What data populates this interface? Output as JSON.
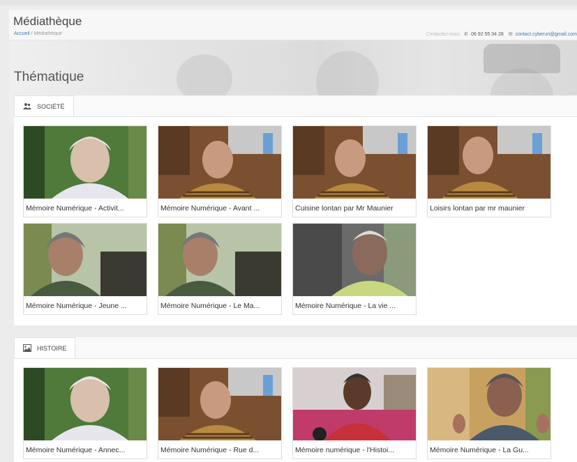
{
  "header": {
    "title": "Médiathèque",
    "breadcrumb_home": "Accueil",
    "breadcrumb_sep": "/",
    "breadcrumb_current": "Médiathèque",
    "contact_label": "Contactez-nous",
    "phone": "06 92 55 34 28",
    "email": "contact.cyberun@gmail.com"
  },
  "section_title": "Thématique",
  "categories": [
    {
      "label": "SOCIÉTÉ",
      "icon": "users-icon",
      "videos": [
        {
          "title": "Mémoire Numérique - Activit..."
        },
        {
          "title": "Mémoire Numérique - Avant ..."
        },
        {
          "title": "Cuisine lontan par Mr Maunier"
        },
        {
          "title": "Loisirs lontan par mr maunier"
        },
        {
          "title": "Mémoire Numérique - Jeune ..."
        },
        {
          "title": "Mémoire Numérique - Le Ma..."
        },
        {
          "title": "Mémoire Numérique - La vie ..."
        }
      ]
    },
    {
      "label": "HISTOIRE",
      "icon": "image-icon",
      "videos": [
        {
          "title": "Mémoire Numérique - Annec..."
        },
        {
          "title": "Mémoire Numérique - Rue d..."
        },
        {
          "title": "Mémoire numérique - l'Histoi..."
        },
        {
          "title": "Mémoire Numérique - La Gu..."
        }
      ]
    }
  ]
}
